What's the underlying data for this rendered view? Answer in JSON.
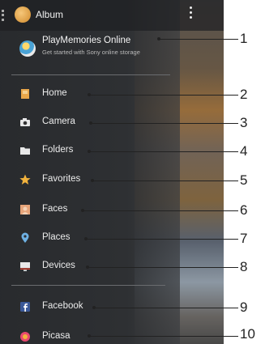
{
  "header": {
    "title": "Album"
  },
  "playmemories": {
    "title": "PlayMemories Online",
    "subtitle": "Get started with Sony online storage"
  },
  "menu": {
    "items": [
      {
        "label": "Home",
        "icon": "home-icon"
      },
      {
        "label": "Camera",
        "icon": "camera-icon"
      },
      {
        "label": "Folders",
        "icon": "folder-icon"
      },
      {
        "label": "Favorites",
        "icon": "star-icon"
      },
      {
        "label": "Faces",
        "icon": "faces-icon"
      },
      {
        "label": "Places",
        "icon": "map-pin-icon"
      },
      {
        "label": "Devices",
        "icon": "devices-icon"
      },
      {
        "label": "Facebook",
        "icon": "facebook-icon"
      },
      {
        "label": "Picasa",
        "icon": "picasa-icon"
      }
    ]
  },
  "callouts": [
    "1",
    "2",
    "3",
    "4",
    "5",
    "6",
    "7",
    "8",
    "9",
    "10"
  ],
  "colors": {
    "drawer_bg": "#2d2f32",
    "accent_star": "#f2b33d",
    "facebook_blue": "#3b5998"
  }
}
